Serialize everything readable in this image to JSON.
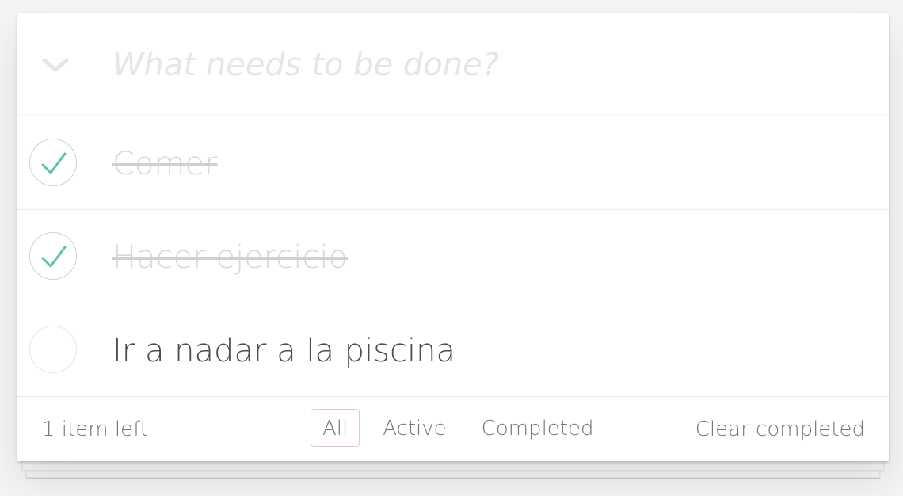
{
  "new_todo": {
    "placeholder": "What needs to be done?",
    "value": ""
  },
  "todos": [
    {
      "title": "Comer",
      "completed": true
    },
    {
      "title": "Hacer ejercicio",
      "completed": true
    },
    {
      "title": "Ir a nadar a la piscina",
      "completed": false
    }
  ],
  "footer": {
    "count_label": "1 item left",
    "filters": [
      "All",
      "Active",
      "Completed"
    ],
    "selected_filter": "All",
    "clear_label": "Clear completed"
  },
  "colors": {
    "check_green": "#5dc2af",
    "check_border": "#bddad5",
    "selected_filter_border": "#e8c6c9",
    "completed_text": "#d9d9d9"
  },
  "icons": {
    "toggle_all": "chevron-down-icon",
    "done": "checkmark-icon"
  }
}
